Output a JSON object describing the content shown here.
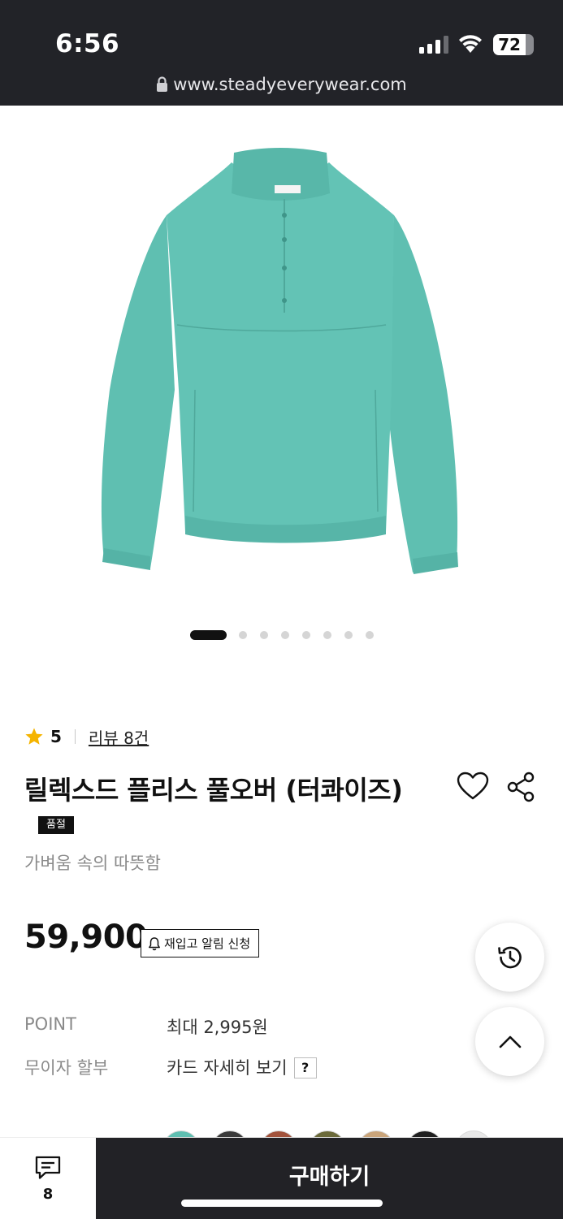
{
  "status_bar": {
    "time": "6:56",
    "battery": "72"
  },
  "browser": {
    "url": "www.steadyeverywear.com"
  },
  "product": {
    "image_icon": "turquoise-fleece-pullover-image",
    "carousel": {
      "current": 1,
      "total": 8
    },
    "rating_score": "5",
    "review_link": "리뷰 8건",
    "title": "릴렉스드 플리스 풀오버 (터콰이즈)",
    "badge": "품절",
    "subtitle": "가벼움 속의 따뜻함",
    "price": "59,900",
    "restock_button": "재입고 알림 신청",
    "info": [
      {
        "label": "POINT",
        "value": "최대 2,995원"
      },
      {
        "label": "무이자 할부",
        "value": "카드 자세히 보기"
      }
    ],
    "help_mark": "?"
  },
  "bottom": {
    "chat_count": "8",
    "buy_label": "구매하기"
  },
  "colors": {
    "chrome": "#222328",
    "product": "#5fbfb1",
    "star": "#f5b400",
    "buy_bg": "#222226"
  }
}
